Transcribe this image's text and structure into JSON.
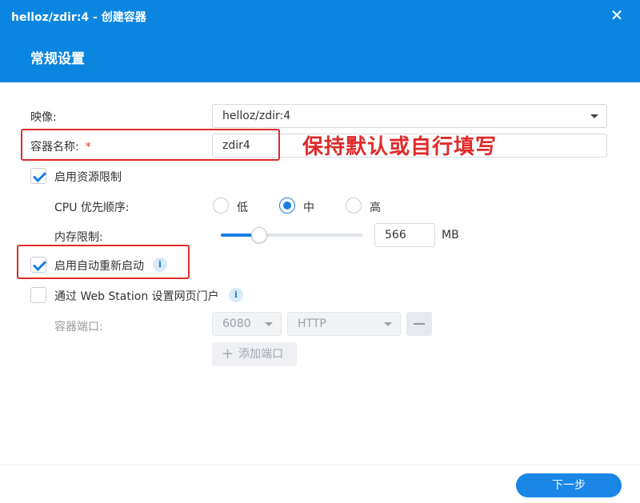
{
  "window": {
    "title": "helloz/zdir:4 - 创建容器",
    "close_icon": "close-icon"
  },
  "page_title": "常规设置",
  "form": {
    "image_label": "映像:",
    "image_value": "helloz/zdir:4",
    "container_name_label": "容器名称:",
    "required_mark": "*",
    "container_name_value": "zdir4",
    "resource_limit_label": "启用资源限制",
    "resource_limit_checked": true,
    "cpu_priority_label": "CPU 优先顺序:",
    "cpu_options": [
      "低",
      "中",
      "高"
    ],
    "cpu_selected": "中",
    "memory_limit_label": "内存限制:",
    "memory_value": "566",
    "memory_unit": "MB",
    "memory_slider_fraction": 0.27,
    "auto_restart_label": "启用自动重新启动",
    "auto_restart_checked": true,
    "webstation_label": "通过 Web Station 设置网页门户",
    "webstation_checked": false,
    "container_port_label": "容器端口:",
    "port_value": "6080",
    "protocol_value": "HTTP",
    "add_port_label": "添加端口"
  },
  "annotation_text": "保持默认或自行填写",
  "footer": {
    "next_label": "下一步"
  },
  "colors": {
    "header_bg": "#0a86e0",
    "accent": "#1a7ee0",
    "annotation": "#e02a2a"
  }
}
